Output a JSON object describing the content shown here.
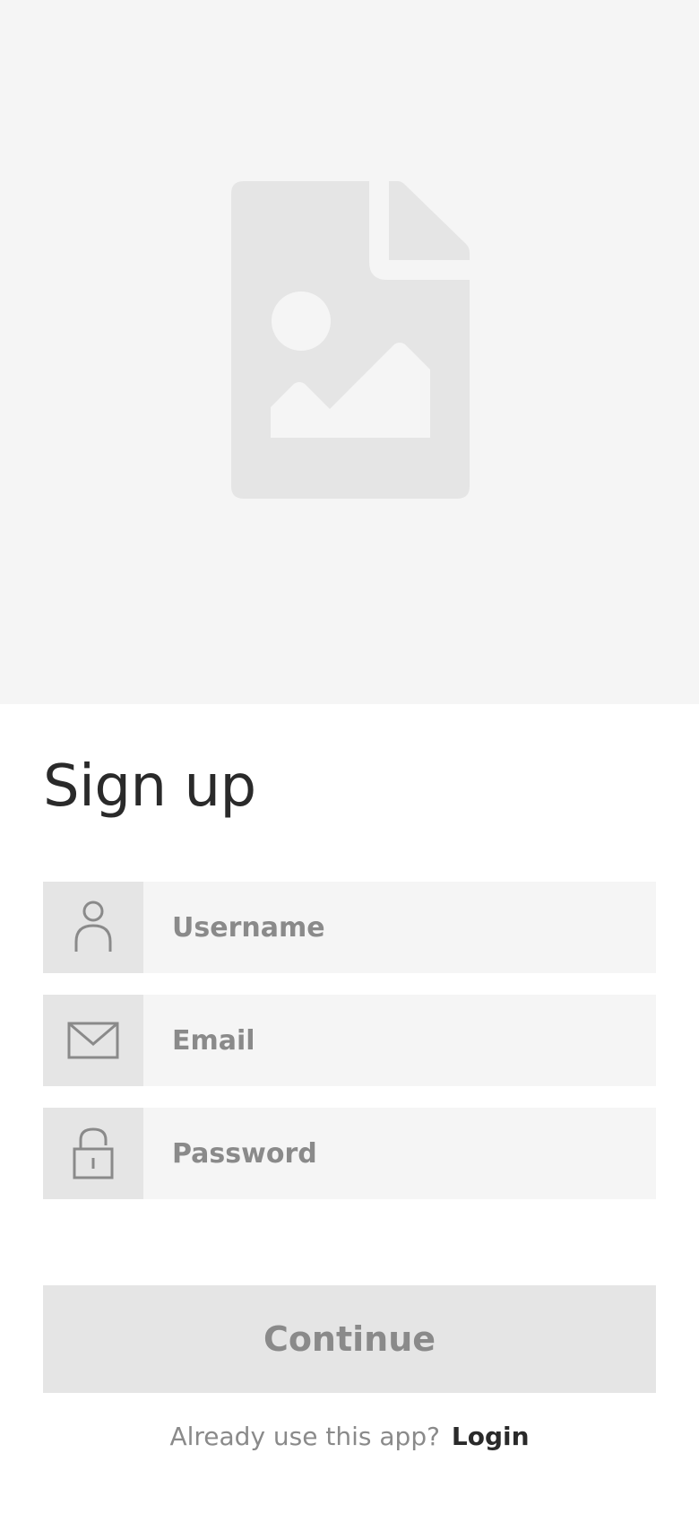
{
  "hero": {
    "image_icon": "image-placeholder-icon"
  },
  "form": {
    "title": "Sign up",
    "fields": [
      {
        "icon": "user-icon",
        "placeholder": "Username"
      },
      {
        "icon": "mail-icon",
        "placeholder": "Email"
      },
      {
        "icon": "lock-icon",
        "placeholder": "Password"
      }
    ],
    "continue_label": "Continue"
  },
  "footer": {
    "prompt": "Already use this app?",
    "login_label": "Login"
  },
  "colors": {
    "hero_bg": "#f5f5f5",
    "field_bg": "#f5f5f5",
    "icon_box_bg": "#e5e5e5",
    "button_bg": "#e5e5e5",
    "muted_text": "#8a8a8a",
    "dark_text": "#2a2a2a"
  }
}
